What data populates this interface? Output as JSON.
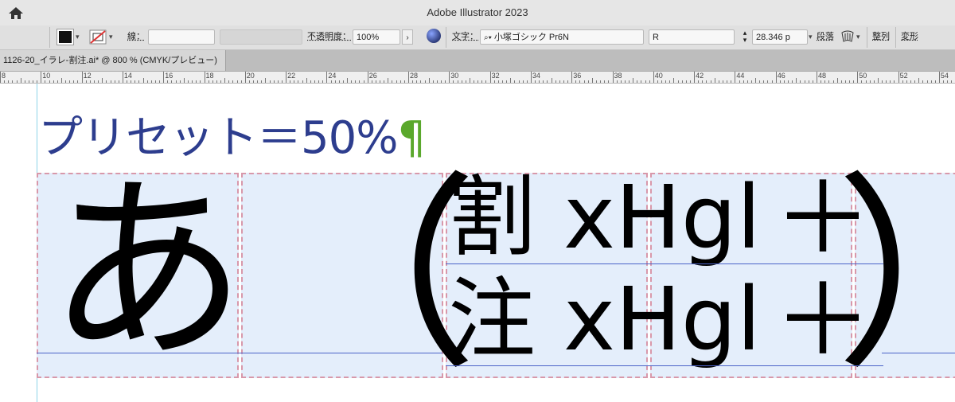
{
  "window": {
    "title": "Adobe Illustrator 2023"
  },
  "control_bar": {
    "stroke_label": "線：",
    "opacity_label": "不透明度：",
    "opacity_value": "100%",
    "character_label": "文字：",
    "font_family": "小塚ゴシック Pr6N",
    "font_style": "R",
    "font_size": "28.346 p",
    "paragraph_label": "段落",
    "align_label": "整列",
    "transform_label": "変形"
  },
  "document_tab": {
    "label": "1126-20_イラレ-割注.ai* @ 800 % (CMYK/プレビュー)"
  },
  "ruler": {
    "ticks": [
      "8",
      "10",
      "12",
      "14",
      "16",
      "18",
      "20",
      "22",
      "24",
      "26",
      "28",
      "30",
      "32",
      "34",
      "36",
      "38",
      "40",
      "42",
      "44",
      "46",
      "48",
      "50",
      "52",
      "54"
    ]
  },
  "artboard": {
    "heading": "プリセット＝50%",
    "pilcrow": "¶",
    "glyph_a": "あ",
    "open_paren": "（",
    "close_paren": "）",
    "warichu_line1": "割 xHgl",
    "warichu_line2": "注 xHgl",
    "plus1": "＋",
    "plus2": "＋"
  },
  "colors": {
    "heading": "#2d3d8e",
    "pilcrow": "#5aa82c",
    "cell_fill": "#e4eefb",
    "cell_border": "#d898aa",
    "baseline": "#4b63c8"
  }
}
